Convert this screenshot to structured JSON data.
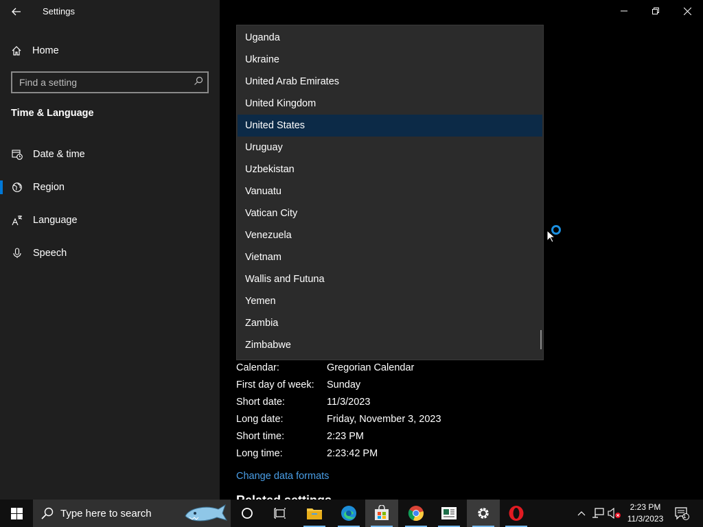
{
  "window": {
    "title": "Settings",
    "controls": [
      "minimize",
      "restore",
      "close"
    ]
  },
  "sidebar": {
    "home_label": "Home",
    "search_placeholder": "Find a setting",
    "section_title": "Time & Language",
    "items": [
      {
        "label": "Date & time",
        "icon": "clock-calendar-icon",
        "selected": false
      },
      {
        "label": "Region",
        "icon": "globe-icon",
        "selected": true
      },
      {
        "label": "Language",
        "icon": "language-icon",
        "selected": false
      },
      {
        "label": "Speech",
        "icon": "microphone-icon",
        "selected": false
      }
    ]
  },
  "country_dropdown": {
    "options": [
      "Uganda",
      "Ukraine",
      "United Arab Emirates",
      "United Kingdom",
      "United States",
      "Uruguay",
      "Uzbekistan",
      "Vanuatu",
      "Vatican City",
      "Venezuela",
      "Vietnam",
      "Wallis and Futuna",
      "Yemen",
      "Zambia",
      "Zimbabwe"
    ],
    "selected": "United States"
  },
  "regional_format": {
    "rows": [
      {
        "label": "Calendar:",
        "value": "Gregorian Calendar"
      },
      {
        "label": "First day of week:",
        "value": "Sunday"
      },
      {
        "label": "Short date:",
        "value": "11/3/2023"
      },
      {
        "label": "Long date:",
        "value": "Friday, November 3, 2023"
      },
      {
        "label": "Short time:",
        "value": "2:23 PM"
      },
      {
        "label": "Long time:",
        "value": "2:23:42 PM"
      }
    ],
    "change_link": "Change data formats"
  },
  "related_settings_title": "Related settings",
  "taskbar": {
    "search_placeholder": "Type here to search",
    "apps": [
      "cortana-icon",
      "task-view-icon",
      "file-explorer-icon",
      "edge-icon",
      "microsoft-store-icon",
      "chrome-icon",
      "news-icon",
      "settings-icon",
      "opera-icon"
    ],
    "clock_time": "2:23 PM",
    "clock_date": "11/3/2023",
    "notification_count": "1"
  },
  "colors": {
    "sidebar_bg": "#1f1f1f",
    "accent": "#0078d7",
    "link": "#4a9fe8",
    "selected_option_bg": "#0c2a47"
  }
}
